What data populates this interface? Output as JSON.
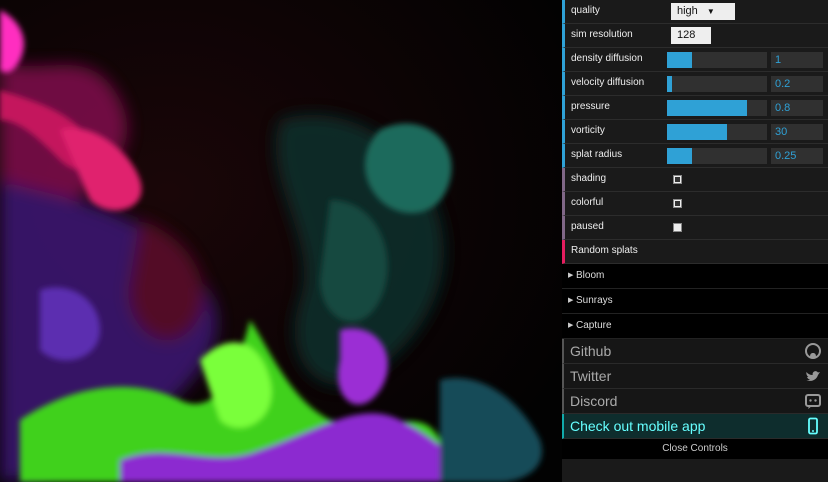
{
  "controls": {
    "quality": {
      "label": "quality",
      "value": "high"
    },
    "sim_resolution": {
      "label": "sim resolution",
      "value": "128"
    },
    "density_diffusion": {
      "label": "density diffusion",
      "value": "1",
      "fill": 0.25
    },
    "velocity_diffusion": {
      "label": "velocity diffusion",
      "value": "0.2",
      "fill": 0.05
    },
    "pressure": {
      "label": "pressure",
      "value": "0.8",
      "fill": 0.8
    },
    "vorticity": {
      "label": "vorticity",
      "value": "30",
      "fill": 0.6
    },
    "splat_radius": {
      "label": "splat radius",
      "value": "0.25",
      "fill": 0.25
    },
    "shading": {
      "label": "shading",
      "checked": true
    },
    "colorful": {
      "label": "colorful",
      "checked": true
    },
    "paused": {
      "label": "paused",
      "checked": false
    },
    "random_splats": {
      "label": "Random splats"
    }
  },
  "folders": [
    {
      "label": "Bloom"
    },
    {
      "label": "Sunrays"
    },
    {
      "label": "Capture"
    }
  ],
  "links": {
    "github": {
      "label": "Github",
      "icon": "github-icon"
    },
    "twitter": {
      "label": "Twitter",
      "icon": "twitter-icon"
    },
    "discord": {
      "label": "Discord",
      "icon": "discord-icon"
    },
    "mobile": {
      "label": "Check out mobile app",
      "icon": "mobile-phone-icon"
    }
  },
  "close_label": "Close Controls",
  "colors": {
    "number_accent": "#2fa1d6",
    "boolean_accent": "#806787",
    "function_accent": "#e61d5f",
    "mobile_highlight": "#66ffff"
  }
}
